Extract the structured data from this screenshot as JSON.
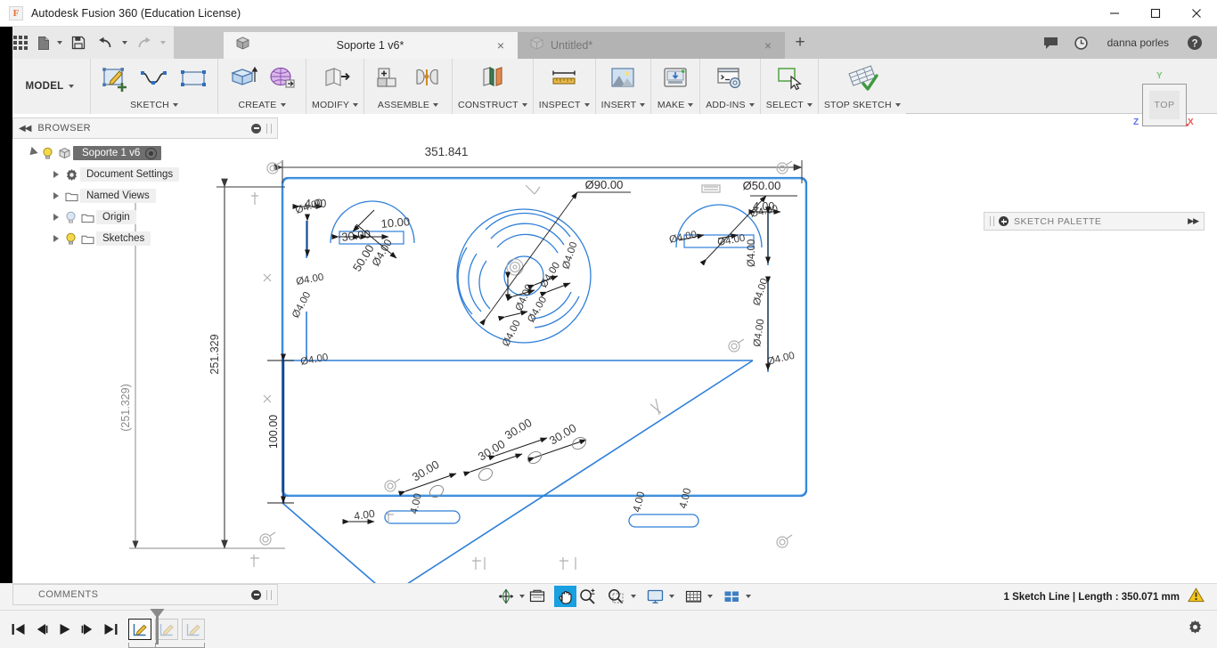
{
  "window": {
    "title": "Autodesk Fusion 360 (Education License)",
    "logo_letter": "F",
    "minimize": "minimize-button",
    "maximize": "maximize-button",
    "close": "close-button"
  },
  "quick_access": {
    "app_grid": "app-grid-icon",
    "new_file": "new-file-icon",
    "save": "save-icon",
    "undo": "undo-icon",
    "redo": "redo-icon"
  },
  "tabs": [
    {
      "label": "Soporte 1 v6*",
      "active": true,
      "close": "×"
    },
    {
      "label": "Untitled*",
      "active": false,
      "close": "×"
    }
  ],
  "tab_add_label": "+",
  "account": {
    "username": "danna porles",
    "notifications_icon": "chat-icon",
    "history_icon": "clock-icon",
    "help_icon": "help-icon"
  },
  "ribbon": {
    "workspace": "MODEL",
    "groups": [
      {
        "label": "SKETCH",
        "tools": [
          "create-sketch-icon",
          "spline-icon",
          "rectangle-icon"
        ]
      },
      {
        "label": "CREATE",
        "tools": [
          "extrude-icon",
          "form-icon"
        ]
      },
      {
        "label": "MODIFY",
        "tools": [
          "press-pull-icon"
        ]
      },
      {
        "label": "ASSEMBLE",
        "tools": [
          "new-component-icon",
          "joint-icon"
        ]
      },
      {
        "label": "CONSTRUCT",
        "tools": [
          "offset-plane-icon"
        ]
      },
      {
        "label": "INSPECT",
        "tools": [
          "measure-icon"
        ]
      },
      {
        "label": "INSERT",
        "tools": [
          "insert-image-icon"
        ]
      },
      {
        "label": "MAKE",
        "tools": [
          "3d-print-icon"
        ]
      },
      {
        "label": "ADD-INS",
        "tools": [
          "scripts-addins-icon"
        ]
      },
      {
        "label": "SELECT",
        "tools": [
          "select-icon"
        ]
      },
      {
        "label": "STOP SKETCH",
        "tools": [
          "stop-sketch-icon"
        ]
      }
    ]
  },
  "view_cube": {
    "face_label": "TOP",
    "axis_y": "Y",
    "axis_x": "X",
    "axis_z": "Z"
  },
  "browser": {
    "title": "BROWSER",
    "collapse_icon": "collapse-left-icon",
    "items": [
      {
        "label": "Soporte 1 v6",
        "icon": "component-icon",
        "expander": "expanded",
        "bulb": "on",
        "root": true
      },
      {
        "label": "Document Settings",
        "icon": "gear-icon",
        "expander": "collapsed",
        "bulb": "none"
      },
      {
        "label": "Named Views",
        "icon": "folder-icon",
        "expander": "collapsed",
        "bulb": "none"
      },
      {
        "label": "Origin",
        "icon": "folder-icon",
        "expander": "collapsed",
        "bulb": "off"
      },
      {
        "label": "Sketches",
        "icon": "folder-icon",
        "expander": "collapsed",
        "bulb": "on"
      }
    ]
  },
  "sketch_palette": {
    "title": "SKETCH PALETTE",
    "expand_icon": "expand-right-icon"
  },
  "comments": {
    "title": "COMMENTS",
    "add_icon": "add-comment-icon"
  },
  "status": {
    "text": "1 Sketch Line | Length : 350.071 mm",
    "warning_icon": "warning-icon"
  },
  "navigation_bar": {
    "tools": [
      {
        "name": "orbit-icon",
        "active": false,
        "caret": true
      },
      {
        "name": "look-at-icon",
        "active": false,
        "caret": false
      },
      {
        "name": "pan-icon",
        "active": true,
        "caret": false
      },
      {
        "name": "zoom-icon",
        "active": false,
        "caret": false
      },
      {
        "name": "zoom-window-icon",
        "active": false,
        "caret": true
      },
      {
        "name": "display-settings-icon",
        "active": false,
        "caret": true
      },
      {
        "name": "grid-snaps-icon",
        "active": false,
        "caret": true
      },
      {
        "name": "viewport-layout-icon",
        "active": false,
        "caret": true
      }
    ]
  },
  "timeline": {
    "controls": [
      "go-to-beginning-icon",
      "step-back-icon",
      "play-icon",
      "step-forward-icon",
      "go-to-end-icon"
    ],
    "features": [
      {
        "icon": "sketch-feature-icon",
        "selected": true
      },
      {
        "icon": "sketch-feature-icon",
        "selected": false
      },
      {
        "icon": "sketch-feature-icon",
        "selected": false
      }
    ],
    "settings_icon": "gear-icon"
  },
  "sketch": {
    "dimensions": {
      "overall_width": "351.841",
      "overall_height_ref": "(251.329)",
      "overall_height": "251.329",
      "vertical_100": "100.00",
      "dia_90": "Ø90.00",
      "dia_50": "Ø50.00",
      "dia_4": "Ø4.00",
      "len_10": "10.00",
      "len_30": "30.00",
      "len_50": "50.00",
      "len_4": "4.00"
    },
    "colors": {
      "sketch_line": "#1f5fd0",
      "dimension": "#4a4a4a",
      "driven_dimension": "#9a9a9a",
      "selected": "#1a9fe0"
    }
  }
}
